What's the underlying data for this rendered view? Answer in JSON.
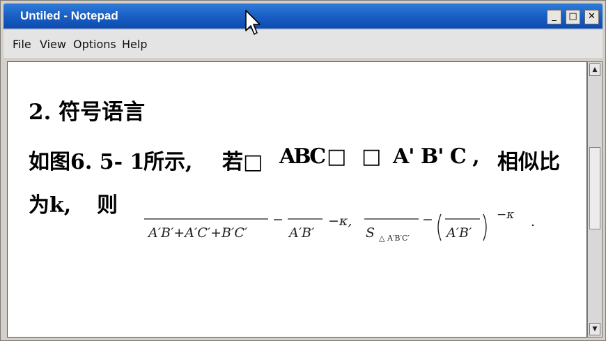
{
  "window": {
    "title": "Untiled - Notepad",
    "buttons": {
      "minimize": "_",
      "maximize": "□",
      "close": "✕"
    }
  },
  "menu": [
    "File",
    "View",
    "Options",
    "Help"
  ],
  "document": {
    "heading": "2.   符号语言",
    "line1": {
      "seg1": "如图6. 5- 1",
      "seg2": "所示,",
      "seg3": "若□",
      "seg4": "ABC",
      "seg5": "□",
      "seg6": "□",
      "seg7": "A' B' C ,",
      "seg8": "相似比"
    },
    "line2": {
      "seg1": "为k,",
      "seg2": "则"
    },
    "formula": {
      "den1": "A′B′+A′C′+B′C′",
      "eq1": "−",
      "den2": "A′B′",
      "k1": "−κ,",
      "s_sym": "S",
      "s_sub": "△ A′B′C′",
      "eq2": "−",
      "den3": "A′B′",
      "k2": "−κ",
      "dot": "."
    }
  },
  "scrollbar": {
    "up": "▲",
    "down": "▼"
  }
}
